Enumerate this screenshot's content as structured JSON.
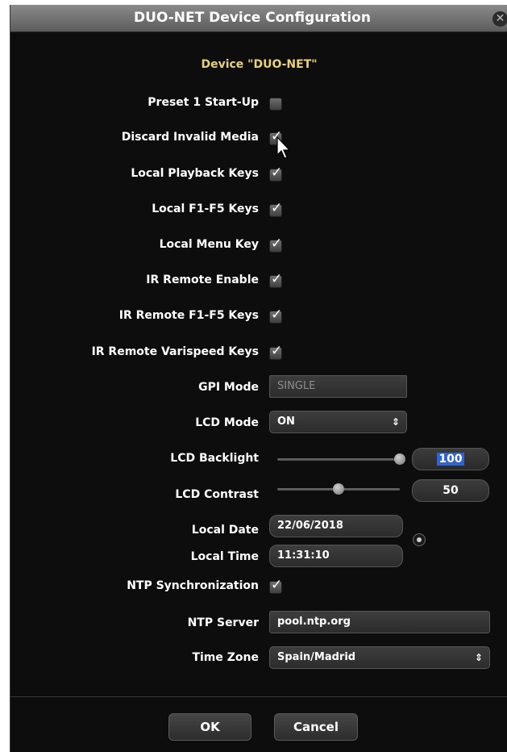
{
  "window": {
    "title": "DUO-NET Device Configuration",
    "close_icon": "close-icon"
  },
  "heading": "Device \"DUO-NET\"",
  "checkboxes": [
    {
      "label": "Preset 1 Start-Up",
      "checked": false
    },
    {
      "label": "Discard Invalid Media",
      "checked": true
    },
    {
      "label": "Local Playback Keys",
      "checked": true
    },
    {
      "label": "Local F1-F5 Keys",
      "checked": true
    },
    {
      "label": "Local Menu Key",
      "checked": true
    },
    {
      "label": "IR Remote Enable",
      "checked": true
    },
    {
      "label": "IR Remote F1-F5 Keys",
      "checked": true
    },
    {
      "label": "IR Remote Varispeed Keys",
      "checked": true
    }
  ],
  "check_glyph": "✓",
  "gpi_mode": {
    "label": "GPI Mode",
    "value": "SINGLE"
  },
  "lcd_mode": {
    "label": "LCD Mode",
    "value": "ON",
    "arrows": "⇕"
  },
  "lcd_backlight": {
    "label": "LCD Backlight",
    "value": "100",
    "level": 1.0
  },
  "lcd_contrast": {
    "label": "LCD Contrast",
    "value": "50",
    "level": 0.5
  },
  "local_date": {
    "label": "Local Date",
    "value": "22/06/2018"
  },
  "local_time": {
    "label": "Local Time",
    "value": "11:31:10"
  },
  "ntp_sync": {
    "label": "NTP Synchronization",
    "checked": true
  },
  "ntp_server": {
    "label": "NTP Server",
    "value": "pool.ntp.org"
  },
  "time_zone": {
    "label": "Time Zone",
    "value": "Spain/Madrid",
    "arrows": "⇕"
  },
  "buttons": {
    "ok": "OK",
    "cancel": "Cancel"
  },
  "colors": {
    "heading": "#e9d27a",
    "selection": "#2f64d6",
    "background": "#0d0d0d"
  }
}
